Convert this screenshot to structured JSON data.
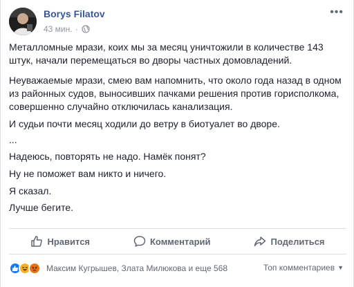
{
  "author": {
    "name": "Borys Filatov"
  },
  "meta": {
    "time": "43 мин.",
    "separator": "·"
  },
  "post": {
    "paragraphs": [
      "Металломные мрази, коих мы за месяц уничтожили в количестве 143 штук, начали перемещаться во дворы частных домовладений.",
      "Неуважаемые мрази, смею вам напомнить, что около года назад в одном из районных судов, выносивших пачками решения против горисполкома, совершенно случайно отключилась канализация.",
      "И судьи почти месяц ходили до ветру в биотуалет во дворе.",
      "...",
      "Надеюсь, повторять не надо. Намёк понят?",
      "Ну не поможет вам никто и ничего.",
      "Я сказал.",
      "Лучше бегите."
    ]
  },
  "actions": {
    "like": "Нравится",
    "comment": "Комментарий",
    "share": "Поделиться"
  },
  "reactions": {
    "names": "Максим Кугрышев, Злата Милюкова и еще 568",
    "sort_label": "Топ комментариев",
    "types": [
      "like-icon",
      "haha-icon",
      "angry-icon"
    ]
  },
  "colors": {
    "author": "#365899",
    "meta": "#90949c",
    "like": "#1877f2",
    "haha": "#f7b125",
    "angry": "#e9710f"
  }
}
